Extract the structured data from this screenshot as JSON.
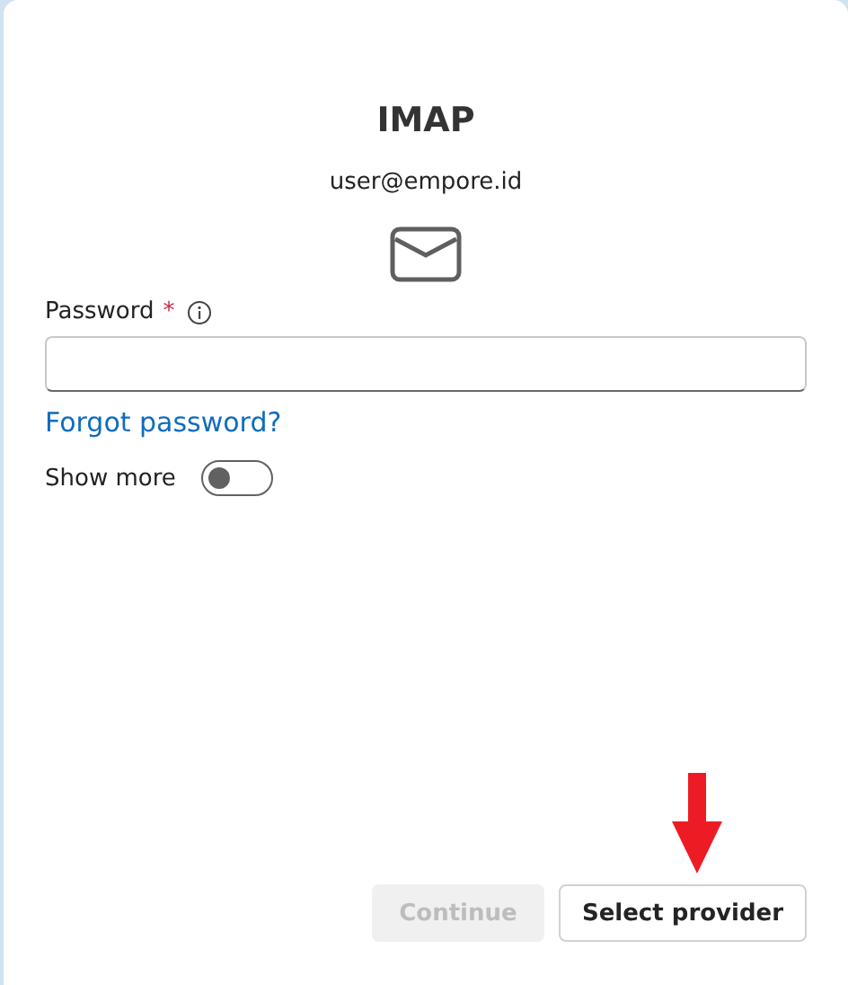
{
  "dialog": {
    "title": "IMAP",
    "account": "user@empore.id"
  },
  "password": {
    "label": "Password",
    "required_mark": "*"
  },
  "forgot_link": "Forgot password?",
  "show_more": {
    "label": "Show more",
    "on": false
  },
  "buttons": [
    {
      "label": "Continue",
      "disabled": true
    },
    {
      "label": "Select provider",
      "disabled": false
    }
  ],
  "annotation_arrow": true
}
